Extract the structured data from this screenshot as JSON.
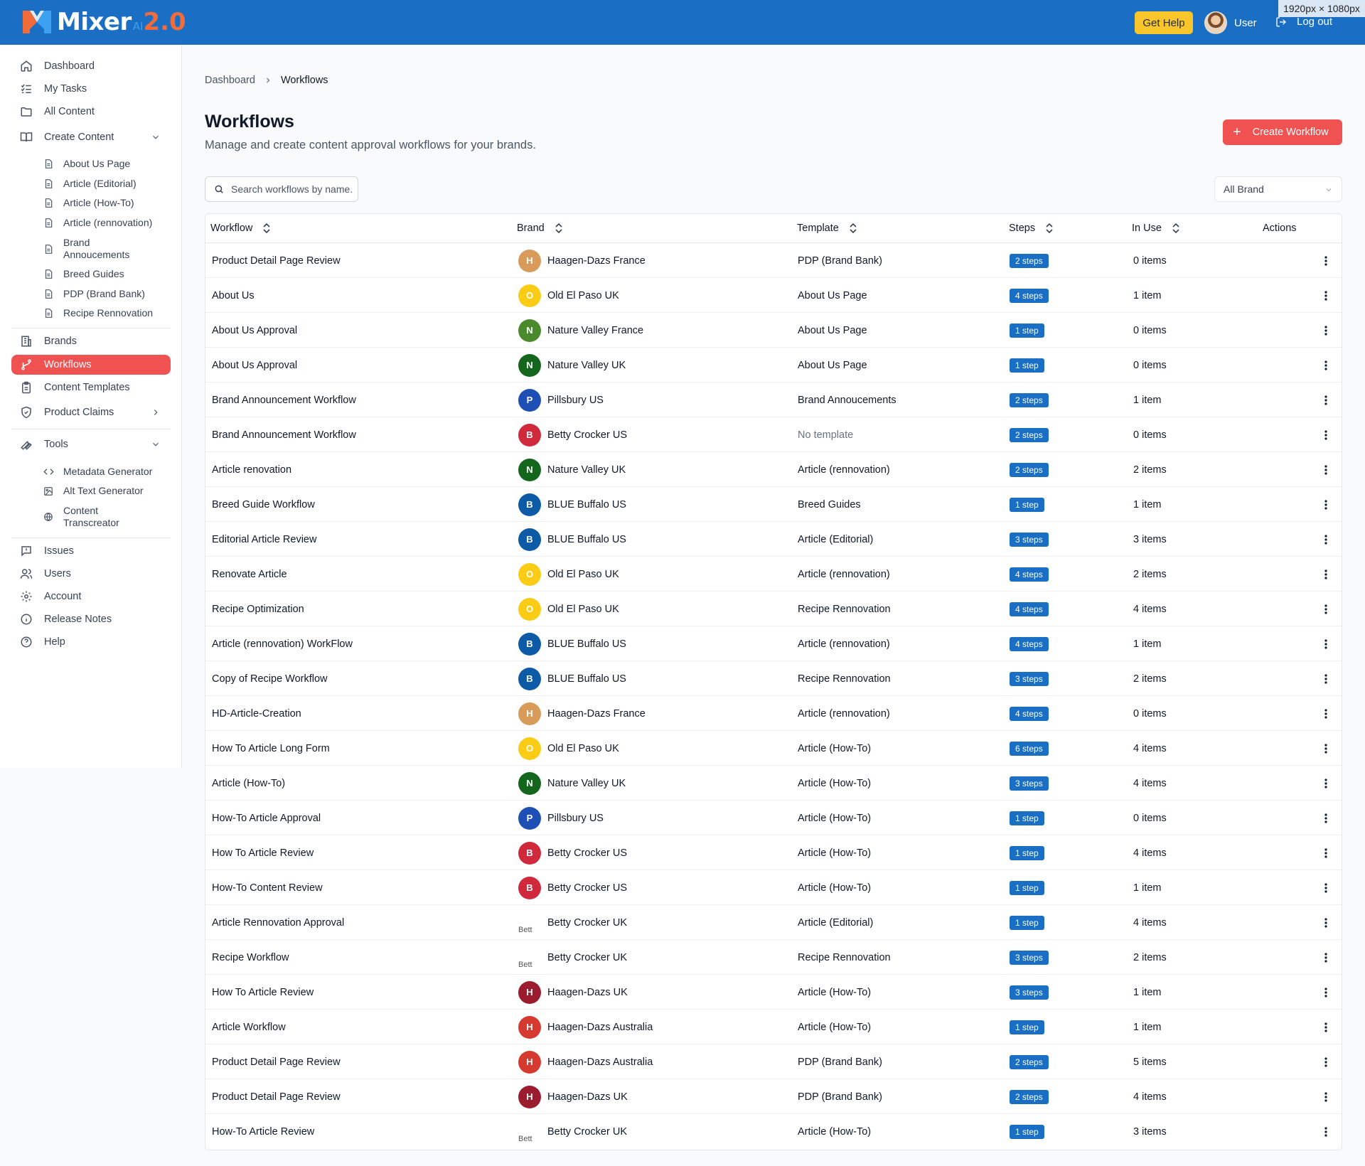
{
  "header": {
    "logo_text": "Mixer",
    "logo_ai": "AI",
    "logo_version": "2.0",
    "help_label": "Get Help",
    "user_name": "User",
    "logout_label": "Log out",
    "dimensions_tag": "1920px × 1080px",
    "colors": {
      "bar": "#1a6fc4",
      "help": "#f8c62a",
      "accent": "#f05252"
    }
  },
  "sidebar": {
    "items": [
      {
        "label": "Dashboard",
        "icon": "home-icon"
      },
      {
        "label": "My Tasks",
        "icon": "list-check-icon"
      },
      {
        "label": "All Content",
        "icon": "folder-icon"
      },
      {
        "label": "Create Content",
        "icon": "book-open-icon"
      },
      {
        "label": "Brands",
        "icon": "building-icon"
      },
      {
        "label": "Workflows",
        "icon": "git-branch-icon"
      },
      {
        "label": "Content Templates",
        "icon": "clipboard-icon"
      },
      {
        "label": "Product Claims",
        "icon": "shield-check-icon"
      },
      {
        "label": "Tools",
        "icon": "wrench-icon"
      },
      {
        "label": "Issues",
        "icon": "message-square-icon"
      },
      {
        "label": "Users",
        "icon": "users-icon"
      },
      {
        "label": "Account",
        "icon": "gear-icon"
      },
      {
        "label": "Release Notes",
        "icon": "info-icon"
      },
      {
        "label": "Help",
        "icon": "help-circle-icon"
      }
    ],
    "create_content_sub": [
      {
        "label": "About Us Page"
      },
      {
        "label": "Article (Editorial)"
      },
      {
        "label": "Article (How-To)"
      },
      {
        "label": "Article (rennovation)"
      },
      {
        "label": "Brand Annoucements"
      },
      {
        "label": "Breed Guides"
      },
      {
        "label": "PDP (Brand Bank)"
      },
      {
        "label": "Recipe Rennovation"
      }
    ],
    "tools_sub": [
      {
        "label": "Metadata Generator",
        "icon": "code-icon"
      },
      {
        "label": "Alt Text Generator",
        "icon": "image-icon"
      },
      {
        "label": "Content Transcreator",
        "icon": "globe-icon"
      }
    ]
  },
  "breadcrumb": {
    "root": "Dashboard",
    "current": "Workflows"
  },
  "page": {
    "title": "Workflows",
    "subtitle": "Manage and create content approval workflows for your brands.",
    "create_label": "Create Workflow"
  },
  "search": {
    "placeholder": "Search workflows by name...",
    "value": ""
  },
  "brand_filter": {
    "selected": "All Brand"
  },
  "table": {
    "headers": {
      "workflow": "Workflow",
      "brand": "Brand",
      "template": "Template",
      "steps": "Steps",
      "in_use": "In Use",
      "actions": "Actions"
    },
    "rows": [
      {
        "workflow": "Product Detail Page Review",
        "brand": "Haagen-Dazs France",
        "initial": "H",
        "color": "#d89b5a",
        "template": "PDP (Brand Bank)",
        "steps": "2 steps",
        "in_use": "0 items"
      },
      {
        "workflow": "About Us",
        "brand": "Old El Paso UK",
        "initial": "O",
        "color": "#facc15",
        "template": "About Us Page",
        "steps": "4 steps",
        "in_use": "1 item"
      },
      {
        "workflow": "About Us Approval",
        "brand": "Nature Valley France",
        "initial": "N",
        "color": "#4a8a2c",
        "template": "About Us Page",
        "steps": "1 step",
        "in_use": "0 items"
      },
      {
        "workflow": "About Us Approval",
        "brand": "Nature Valley UK",
        "initial": "N",
        "color": "#15661d",
        "template": "About Us Page",
        "steps": "1 step",
        "in_use": "0 items"
      },
      {
        "workflow": "Brand Announcement Workflow",
        "brand": "Pillsbury US",
        "initial": "P",
        "color": "#1e4fb4",
        "template": "Brand Annoucements",
        "steps": "2 steps",
        "in_use": "1 item"
      },
      {
        "workflow": "Brand Announcement Workflow",
        "brand": "Betty Crocker US",
        "initial": "B",
        "color": "#d0293c",
        "template": "No template",
        "steps": "2 steps",
        "in_use": "0 items"
      },
      {
        "workflow": "Article renovation",
        "brand": "Nature Valley UK",
        "initial": "N",
        "color": "#15661d",
        "template": "Article (rennovation)",
        "steps": "2 steps",
        "in_use": "2 items"
      },
      {
        "workflow": "Breed Guide Workflow",
        "brand": "BLUE Buffalo US",
        "initial": "B",
        "color": "#0d5aa7",
        "template": "Breed Guides",
        "steps": "1 step",
        "in_use": "1 item"
      },
      {
        "workflow": "Editorial Article Review",
        "brand": "BLUE Buffalo US",
        "initial": "B",
        "color": "#0d5aa7",
        "template": "Article (Editorial)",
        "steps": "3 steps",
        "in_use": "3 items"
      },
      {
        "workflow": "Renovate Article",
        "brand": "Old El Paso UK",
        "initial": "O",
        "color": "#facc15",
        "template": "Article (rennovation)",
        "steps": "4 steps",
        "in_use": "2 items"
      },
      {
        "workflow": "Recipe Optimization",
        "brand": "Old El Paso UK",
        "initial": "O",
        "color": "#facc15",
        "template": "Recipe Rennovation",
        "steps": "4 steps",
        "in_use": "4 items"
      },
      {
        "workflow": "Article (rennovation) WorkFlow",
        "brand": "BLUE Buffalo US",
        "initial": "B",
        "color": "#0d5aa7",
        "template": "Article (rennovation)",
        "steps": "4 steps",
        "in_use": "1 item"
      },
      {
        "workflow": "Copy of Recipe Workflow",
        "brand": "BLUE Buffalo US",
        "initial": "B",
        "color": "#0d5aa7",
        "template": "Recipe Rennovation",
        "steps": "3 steps",
        "in_use": "2 items"
      },
      {
        "workflow": "HD-Article-Creation",
        "brand": "Haagen-Dazs France",
        "initial": "H",
        "color": "#d89b5a",
        "template": "Article (rennovation)",
        "steps": "4 steps",
        "in_use": "0 items"
      },
      {
        "workflow": "How To Article Long Form",
        "brand": "Old El Paso UK",
        "initial": "O",
        "color": "#facc15",
        "template": "Article (How-To)",
        "steps": "6 steps",
        "in_use": "4 items"
      },
      {
        "workflow": "Article (How-To)",
        "brand": "Nature Valley UK",
        "initial": "N",
        "color": "#15661d",
        "template": "Article (How-To)",
        "steps": "3 steps",
        "in_use": "4 items"
      },
      {
        "workflow": "How-To Article Approval",
        "brand": "Pillsbury US",
        "initial": "P",
        "color": "#1e4fb4",
        "template": "Article (How-To)",
        "steps": "1 step",
        "in_use": "0 items"
      },
      {
        "workflow": "How To Article Review",
        "brand": "Betty Crocker US",
        "initial": "B",
        "color": "#d0293c",
        "template": "Article (How-To)",
        "steps": "1 step",
        "in_use": "4 items"
      },
      {
        "workflow": "How-To Content Review",
        "brand": "Betty Crocker US",
        "initial": "B",
        "color": "#d0293c",
        "template": "Article (How-To)",
        "steps": "1 step",
        "in_use": "1 item"
      },
      {
        "workflow": "Article Rennovation Approval",
        "brand": "Betty Crocker UK",
        "initial": "Bett",
        "color": "broken",
        "template": "Article (Editorial)",
        "steps": "1 step",
        "in_use": "4 items"
      },
      {
        "workflow": "Recipe Workflow",
        "brand": "Betty Crocker UK",
        "initial": "Bett",
        "color": "broken",
        "template": "Recipe Rennovation",
        "steps": "3 steps",
        "in_use": "2 items"
      },
      {
        "workflow": "How To Article Review",
        "brand": "Haagen-Dazs UK",
        "initial": "H",
        "color": "#9b1c2e",
        "template": "Article (How-To)",
        "steps": "3 steps",
        "in_use": "1 item"
      },
      {
        "workflow": "Article Workflow",
        "brand": "Haagen-Dazs Australia",
        "initial": "H",
        "color": "#d63a2e",
        "template": "Article (How-To)",
        "steps": "1 step",
        "in_use": "1 item"
      },
      {
        "workflow": "Product Detail Page Review",
        "brand": "Haagen-Dazs Australia",
        "initial": "H",
        "color": "#d63a2e",
        "template": "PDP (Brand Bank)",
        "steps": "2 steps",
        "in_use": "5 items"
      },
      {
        "workflow": "Product Detail Page Review",
        "brand": "Haagen-Dazs UK",
        "initial": "H",
        "color": "#9b1c2e",
        "template": "PDP (Brand Bank)",
        "steps": "2 steps",
        "in_use": "4 items"
      },
      {
        "workflow": "How-To Article Review",
        "brand": "Betty Crocker UK",
        "initial": "Bett",
        "color": "broken",
        "template": "Article (How-To)",
        "steps": "1 step",
        "in_use": "3 items"
      }
    ]
  }
}
